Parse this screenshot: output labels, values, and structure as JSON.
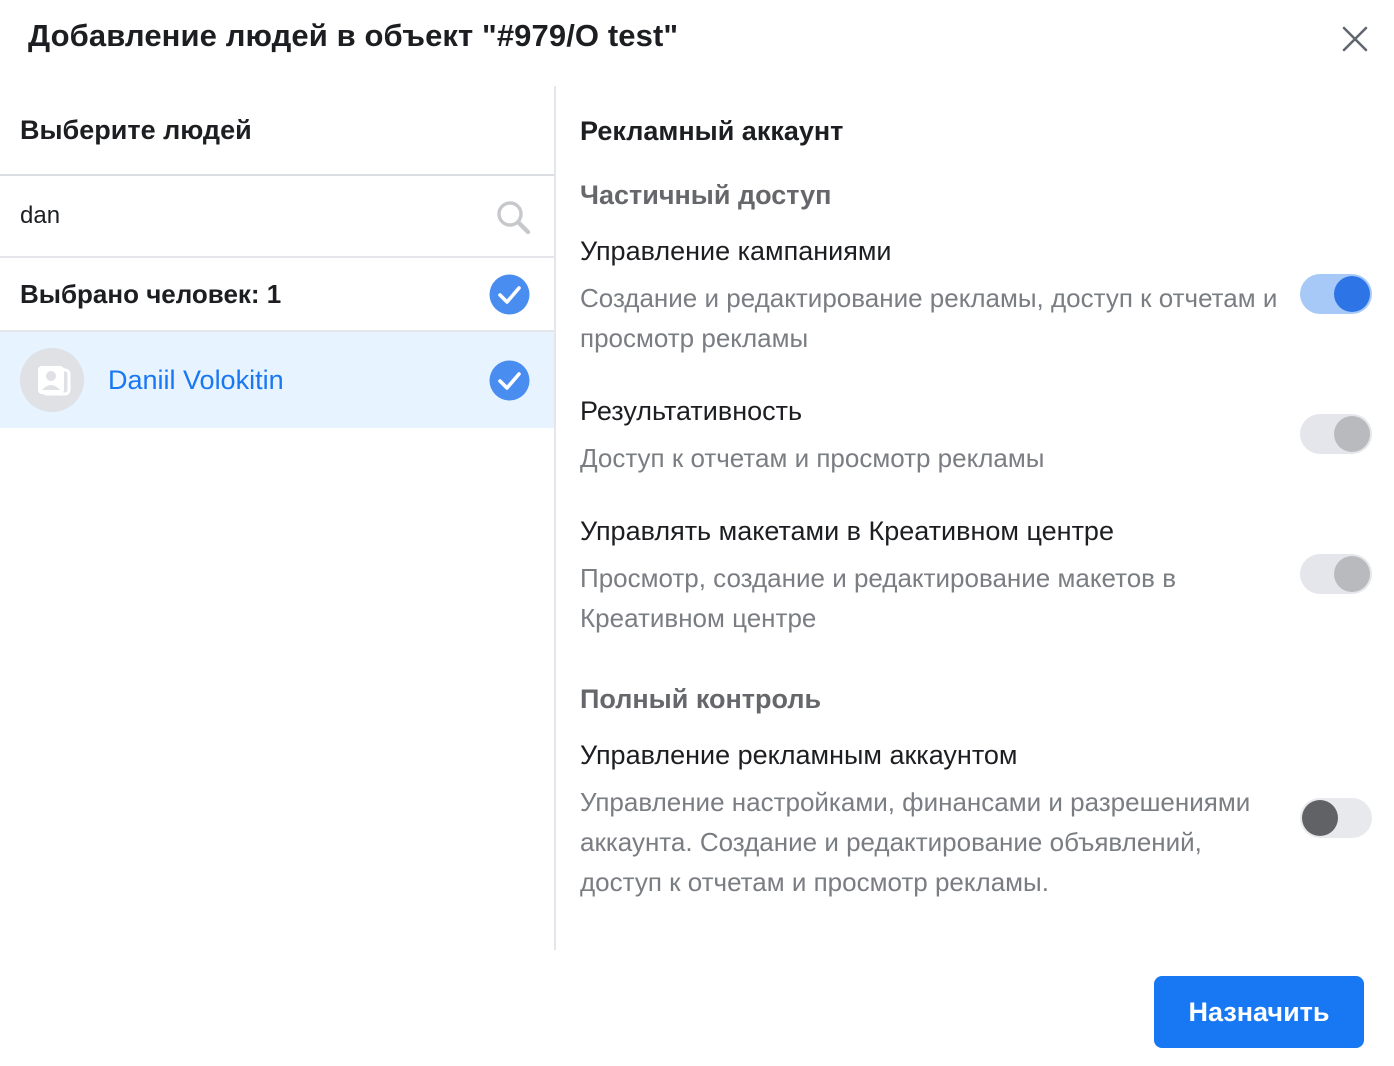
{
  "dialog": {
    "title": "Добавление людей в объект \"#979/O test\"",
    "close_icon": "close-icon"
  },
  "left": {
    "header": "Выберите людей",
    "search": {
      "value": "dan",
      "icon": "search-icon"
    },
    "selected_count_label": "Выбрано человек: 1",
    "selected_people": [
      {
        "name": "Daniil Volokitin",
        "checked": true
      }
    ]
  },
  "right": {
    "title": "Рекламный аккаунт",
    "sections": [
      {
        "label": "Частичный доступ",
        "permissions": [
          {
            "title": "Управление кампаниями",
            "description": "Создание и редактирование рекламы, доступ к отчетам и просмотр рекламы",
            "state": "on"
          },
          {
            "title": "Результативность",
            "description": "Доступ к отчетам и просмотр рекламы",
            "state": "disabled"
          },
          {
            "title": "Управлять макетами в Креативном центре",
            "description": "Просмотр, создание и редактирование макетов в Креативном центре",
            "state": "disabled"
          }
        ]
      },
      {
        "label": "Полный контроль",
        "permissions": [
          {
            "title": "Управление рекламным аккаунтом",
            "description": "Управление настройками, финансами и разрешениями аккаунта. Создание и редактирование объявлений, доступ к отчетам и просмотр рекламы.",
            "state": "off"
          }
        ]
      }
    ]
  },
  "footer": {
    "assign_label": "Назначить"
  },
  "colors": {
    "accent": "#1877f2",
    "toggle_on": "#2d75e6",
    "selected_row": "#e7f3ff"
  }
}
